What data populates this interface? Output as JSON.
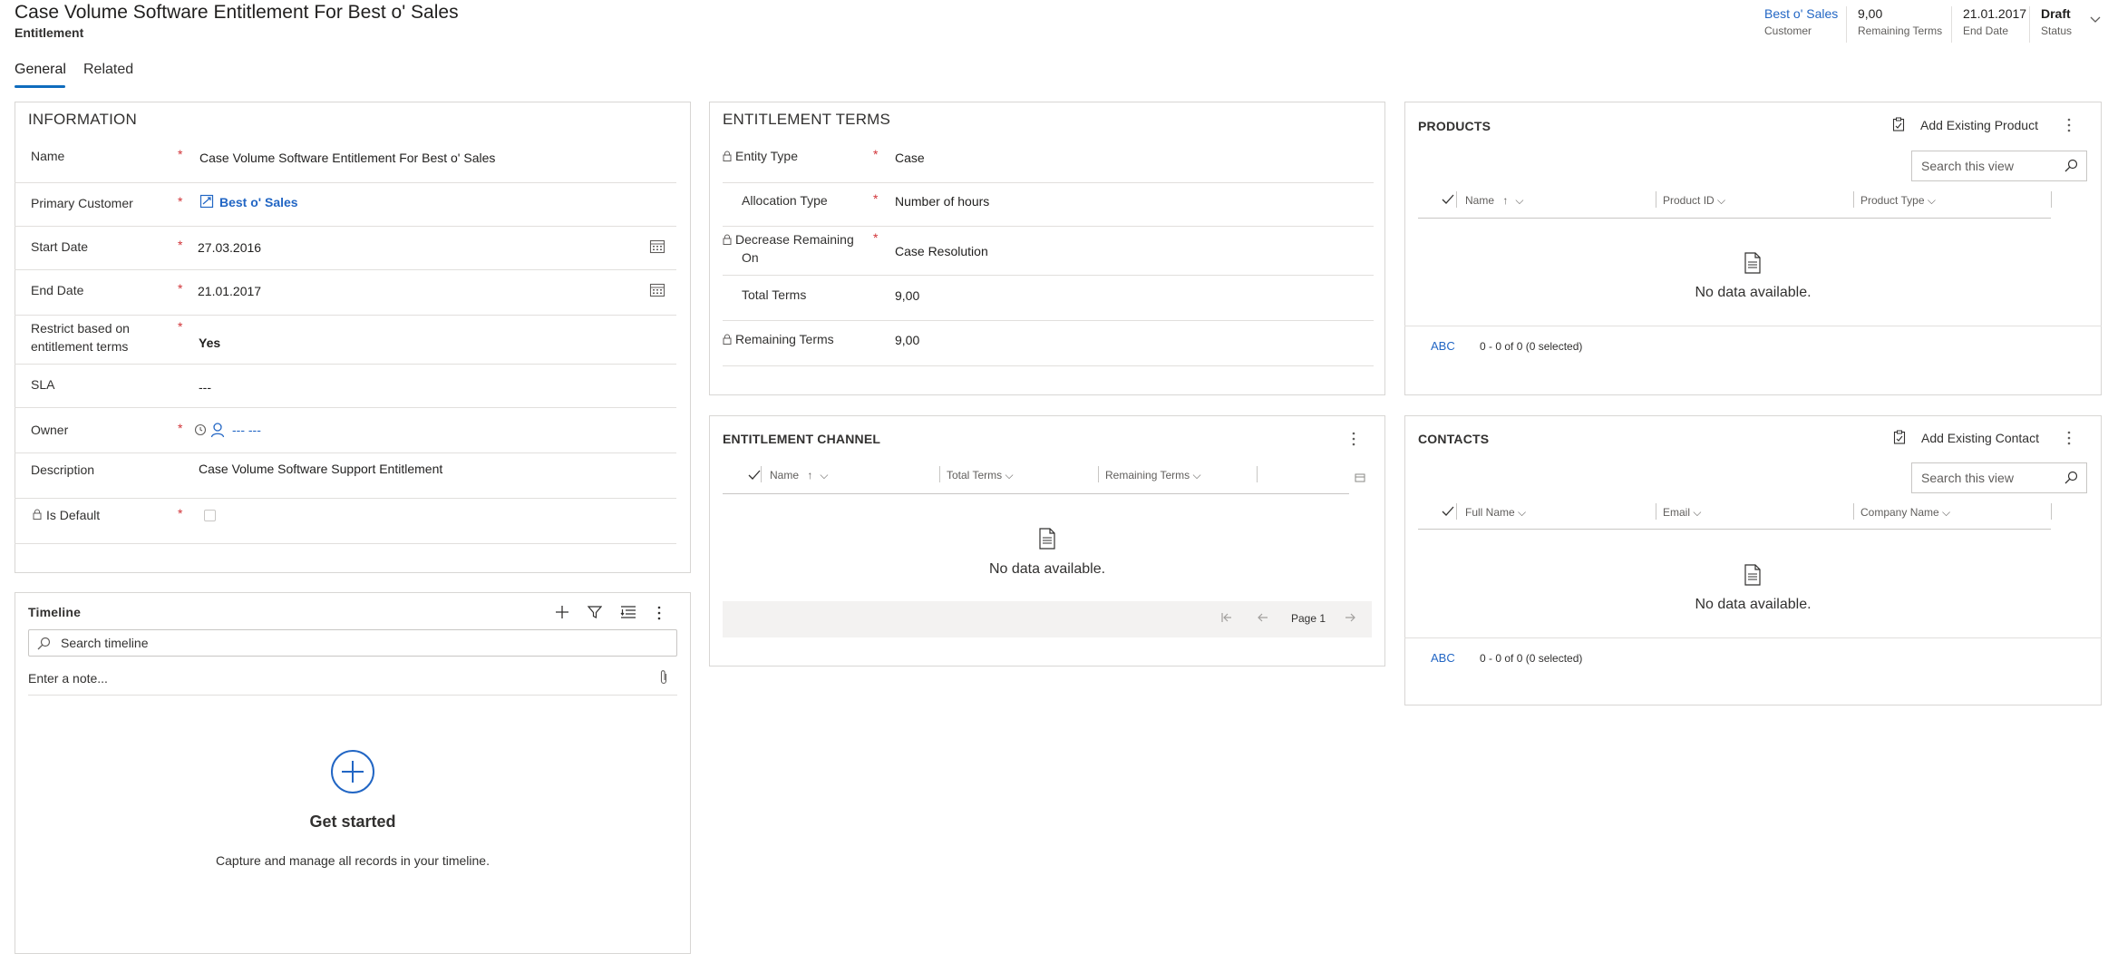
{
  "header": {
    "title": "Case Volume Software Entitlement For Best o' Sales",
    "entity": "Entitlement",
    "fields": [
      {
        "value": "Best o' Sales",
        "label": "Customer"
      },
      {
        "value": "9,00",
        "label": "Remaining Terms"
      },
      {
        "value": "21.01.2017",
        "label": "End Date"
      },
      {
        "value": "Draft",
        "label": "Status"
      }
    ]
  },
  "tabs": [
    {
      "label": "General",
      "active": true
    },
    {
      "label": "Related",
      "active": false
    }
  ],
  "information": {
    "title": "INFORMATION",
    "name": {
      "label": "Name",
      "value": "Case Volume Software Entitlement For Best o' Sales"
    },
    "primary_customer": {
      "label": "Primary Customer",
      "value": "Best o' Sales"
    },
    "start_date": {
      "label": "Start Date",
      "value": "27.03.2016"
    },
    "end_date": {
      "label": "End Date",
      "value": "21.01.2017"
    },
    "restrict": {
      "label_line1": "Restrict based on",
      "label_line2": "entitlement terms",
      "value": "Yes"
    },
    "sla": {
      "label": "SLA",
      "value": "---"
    },
    "owner": {
      "label": "Owner",
      "value": "--- ---"
    },
    "description": {
      "label": "Description",
      "value": "Case Volume Software Support Entitlement"
    },
    "is_default": {
      "label": "Is Default",
      "checked": false
    }
  },
  "timeline": {
    "title": "Timeline",
    "search_placeholder": "Search timeline",
    "note_placeholder": "Enter a note...",
    "empty_title": "Get started",
    "empty_text": "Capture and manage all records in your timeline."
  },
  "terms": {
    "title": "ENTITLEMENT TERMS",
    "entity_type": {
      "label": "Entity Type",
      "value": "Case"
    },
    "allocation_type": {
      "label": "Allocation Type",
      "value": "Number of hours"
    },
    "decrease_remaining": {
      "label_line1": "Decrease Remaining",
      "label_line2": "On",
      "value": "Case Resolution"
    },
    "total_terms": {
      "label": "Total Terms",
      "value": "9,00"
    },
    "remaining_terms": {
      "label": "Remaining Terms",
      "value": "9,00"
    }
  },
  "channel": {
    "title": "ENTITLEMENT CHANNEL",
    "columns": [
      "Name",
      "Total Terms",
      "Remaining Terms"
    ],
    "no_data": "No data available.",
    "page_label": "Page 1"
  },
  "products": {
    "title": "PRODUCTS",
    "add_label": "Add Existing Product",
    "search_placeholder": "Search this view",
    "columns": [
      "Name",
      "Product ID",
      "Product Type"
    ],
    "no_data": "No data available.",
    "abc": "ABC",
    "count": "0 - 0 of 0 (0 selected)"
  },
  "contacts": {
    "title": "CONTACTS",
    "add_label": "Add Existing Contact",
    "search_placeholder": "Search this view",
    "columns": [
      "Full Name",
      "Email",
      "Company Name"
    ],
    "no_data": "No data available.",
    "abc": "ABC",
    "count": "0 - 0 of 0 (0 selected)"
  },
  "colors": {
    "accent": "#0f6cbd",
    "link": "#2266c4",
    "required": "#d13438",
    "border": "#d8d6d4"
  }
}
